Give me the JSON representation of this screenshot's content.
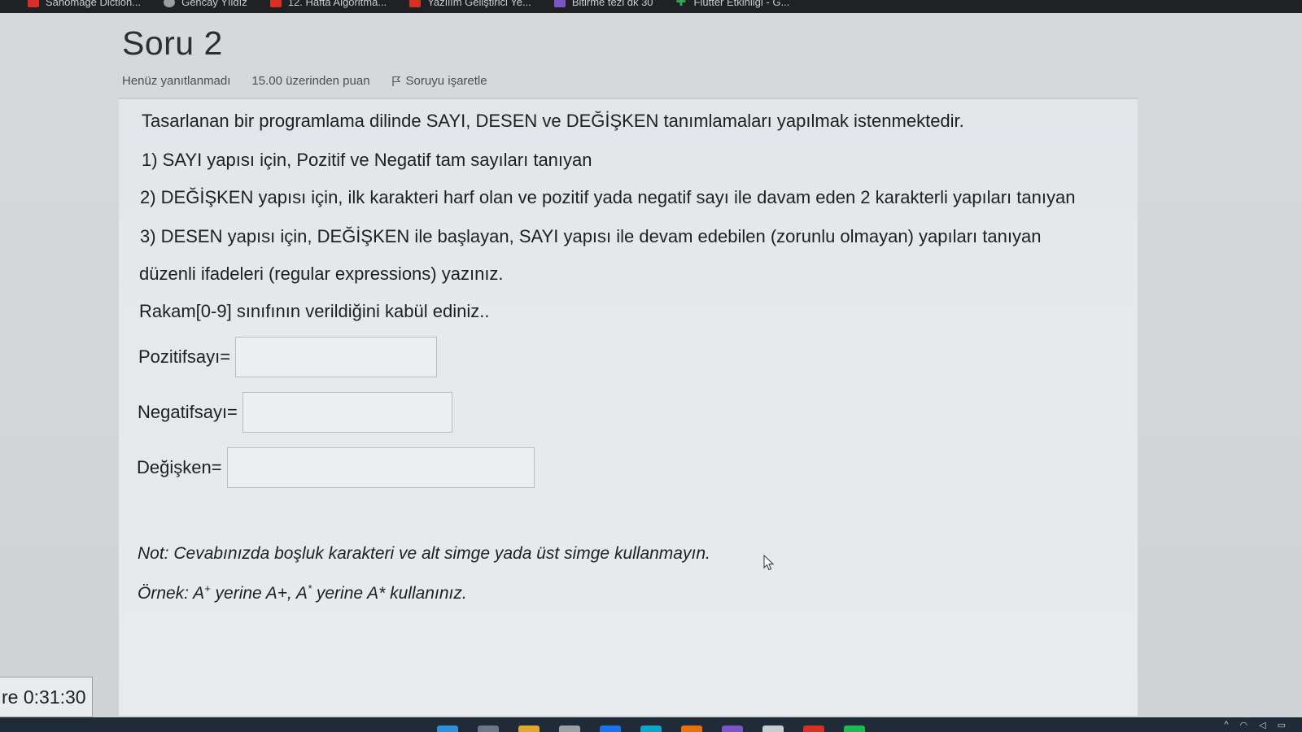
{
  "bookmarks": [
    {
      "label": "Sanomage Diction...",
      "icon": "red"
    },
    {
      "label": "Gencay Yıldız",
      "icon": "grey"
    },
    {
      "label": "12. Hafta Algoritma...",
      "icon": "red"
    },
    {
      "label": "Yazılım Geliştirici Ye...",
      "icon": "red"
    },
    {
      "label": "Bitirme tezi dk 30",
      "icon": "purple"
    },
    {
      "label": "Flutter Etkinliği - G...",
      "icon": "green"
    }
  ],
  "question": {
    "title": "Soru 2",
    "status": "Henüz yanıtlanmadı",
    "points": "15.00 üzerinden puan",
    "flag_label": "Soruyu işaretle",
    "lines": [
      "Tasarlanan bir programlama dilinde SAYI, DESEN ve DEĞİŞKEN tanımlamaları yapılmak istenmektedir.",
      "1) SAYI yapısı için, Pozitif ve Negatif tam sayıları tanıyan",
      "2) DEĞİŞKEN yapısı için, ilk karakteri harf olan ve pozitif yada negatif sayı ile davam eden 2 karakterli yapıları tanıyan",
      "3) DESEN yapısı için, DEĞİŞKEN ile başlayan, SAYI yapısı ile devam edebilen (zorunlu olmayan) yapıları tanıyan",
      "düzenli ifadeleri (regular expressions) yazınız.",
      "Rakam[0-9] sınıfının verildiğini kabül ediniz.."
    ],
    "fields": [
      {
        "label": "Pozitifsayı=",
        "value": ""
      },
      {
        "label": "Negatifsayı=",
        "value": ""
      },
      {
        "label": "Değişken=",
        "value": ""
      }
    ],
    "note": "Not: Cevabınızda boşluk karakteri ve alt simge yada üst simge kullanmayın.",
    "example": {
      "prefix": "Örnek: A",
      "sup1": "+",
      "mid1": " yerine A+,  A",
      "sup2": "*",
      "mid2": " yerine A* kullanınız."
    }
  },
  "timer": {
    "text": "re 0:31:30"
  }
}
